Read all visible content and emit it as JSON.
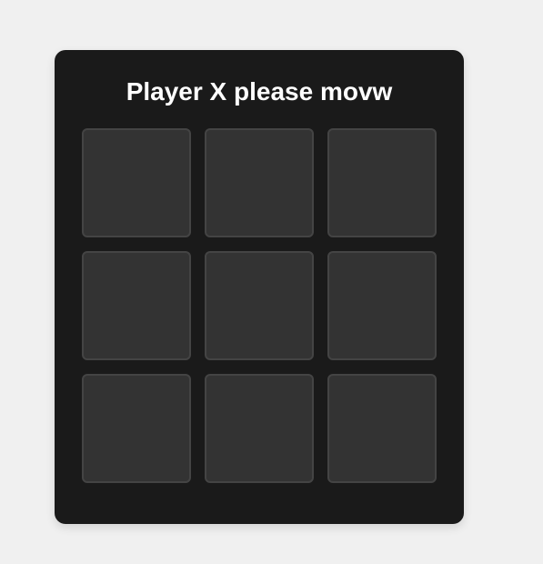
{
  "status_text": "Player X please movw",
  "current_player": "X",
  "board": {
    "cells": [
      "",
      "",
      "",
      "",
      "",
      "",
      "",
      "",
      ""
    ]
  },
  "colors": {
    "page_background": "#f0f0f0",
    "card_background": "#1a1a1a",
    "cell_background": "#333333",
    "cell_border": "#444444",
    "text": "#ffffff"
  }
}
